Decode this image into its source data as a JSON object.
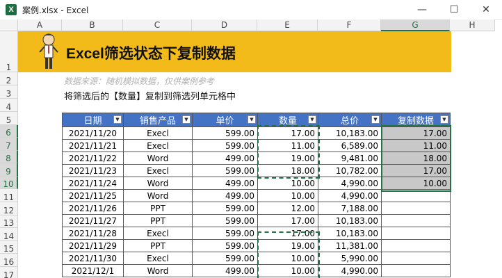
{
  "window": {
    "icon": "excel-icon",
    "title": "案例.xlsx - Excel",
    "controls": [
      "minimize-icon",
      "maximize-icon",
      "close-icon"
    ]
  },
  "columns": [
    "A",
    "B",
    "C",
    "D",
    "E",
    "F",
    "G",
    "H"
  ],
  "selected_column": "G",
  "rows": [
    "1",
    "2",
    "3",
    "4",
    "5",
    "6",
    "7",
    "8",
    "9",
    "10",
    "11",
    "12",
    "13",
    "14",
    "15",
    "16",
    "17"
  ],
  "selected_rows": [
    "6",
    "7",
    "8",
    "9",
    "10"
  ],
  "banner": {
    "title": "Excel筛选状态下复制数据",
    "background": "#F3BB1A"
  },
  "notes": {
    "source": "数据来源：随机模拟数据，仅供案例参考",
    "instruction": "将筛选后的【数量】复制到筛选列单元格中"
  },
  "table": {
    "header_color": "#4472C4",
    "headers": [
      "日期",
      "销售产品",
      "单价",
      "数量",
      "总价",
      "复制数据"
    ],
    "rows": [
      {
        "date": "2021/11/20",
        "product": "Execl",
        "price": "599.00",
        "qty": "17.00",
        "total": "10,183.00",
        "copy": "17.00"
      },
      {
        "date": "2021/11/21",
        "product": "Execl",
        "price": "599.00",
        "qty": "11.00",
        "total": "6,589.00",
        "copy": "11.00"
      },
      {
        "date": "2021/11/22",
        "product": "Word",
        "price": "499.00",
        "qty": "19.00",
        "total": "9,481.00",
        "copy": "18.00"
      },
      {
        "date": "2021/11/23",
        "product": "Execl",
        "price": "599.00",
        "qty": "18.00",
        "total": "10,782.00",
        "copy": "17.00"
      },
      {
        "date": "2021/11/24",
        "product": "Word",
        "price": "499.00",
        "qty": "10.00",
        "total": "4,990.00",
        "copy": "10.00"
      },
      {
        "date": "2021/11/25",
        "product": "Word",
        "price": "499.00",
        "qty": "10.00",
        "total": "4,990.00",
        "copy": ""
      },
      {
        "date": "2021/11/26",
        "product": "PPT",
        "price": "599.00",
        "qty": "12.00",
        "total": "7,188.00",
        "copy": ""
      },
      {
        "date": "2021/11/27",
        "product": "PPT",
        "price": "599.00",
        "qty": "17.00",
        "total": "10,183.00",
        "copy": ""
      },
      {
        "date": "2021/11/28",
        "product": "Execl",
        "price": "599.00",
        "qty": "17.00",
        "total": "10,183.00",
        "copy": ""
      },
      {
        "date": "2021/11/29",
        "product": "PPT",
        "price": "599.00",
        "qty": "19.00",
        "total": "11,381.00",
        "copy": ""
      },
      {
        "date": "2021/11/30",
        "product": "Execl",
        "price": "599.00",
        "qty": "10.00",
        "total": "5,990.00",
        "copy": ""
      },
      {
        "date": "2021/12/1",
        "product": "Word",
        "price": "499.00",
        "qty": "10.00",
        "total": "4,990.00",
        "copy": ""
      }
    ]
  }
}
